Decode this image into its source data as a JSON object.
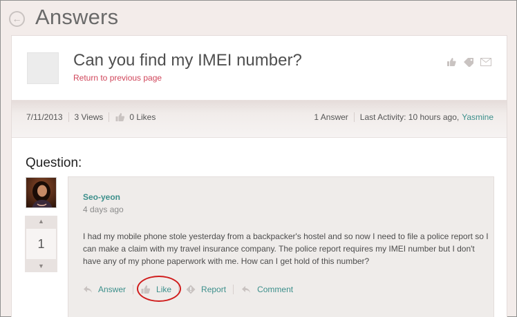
{
  "header": {
    "title": "Answers",
    "back_icon": "back-arrow-icon"
  },
  "question": {
    "title": "Can you find my IMEI number?",
    "return_link": "Return to previous page",
    "header_icons": [
      "thumbs-up-icon",
      "tag-icon",
      "email-icon"
    ]
  },
  "meta": {
    "date": "7/11/2013",
    "views": "3 Views",
    "likes": "0 Likes",
    "answers": "1 Answer",
    "last_activity": "Last Activity: 10 hours ago,",
    "last_user": "Yasmine"
  },
  "section_label": "Question:",
  "vote": {
    "count": "1",
    "up_icon": "triangle-up-icon",
    "down_icon": "triangle-down-icon"
  },
  "post": {
    "author": "Seo-yeon",
    "time": "4 days ago",
    "body": "I had my mobile phone stole yesterday from a backpacker's hostel and so now I need to file a police report so I can make a claim with my travel insurance company. The police report requires my IMEI number but I don't have any of my phone paperwork with me. How can I get hold of this number?",
    "actions": {
      "answer": "Answer",
      "like": "Like",
      "report": "Report",
      "comment": "Comment"
    }
  },
  "colors": {
    "accent_link": "#3c8f8b",
    "return_link": "#d0455a",
    "highlight_ring": "#d01c1c"
  }
}
